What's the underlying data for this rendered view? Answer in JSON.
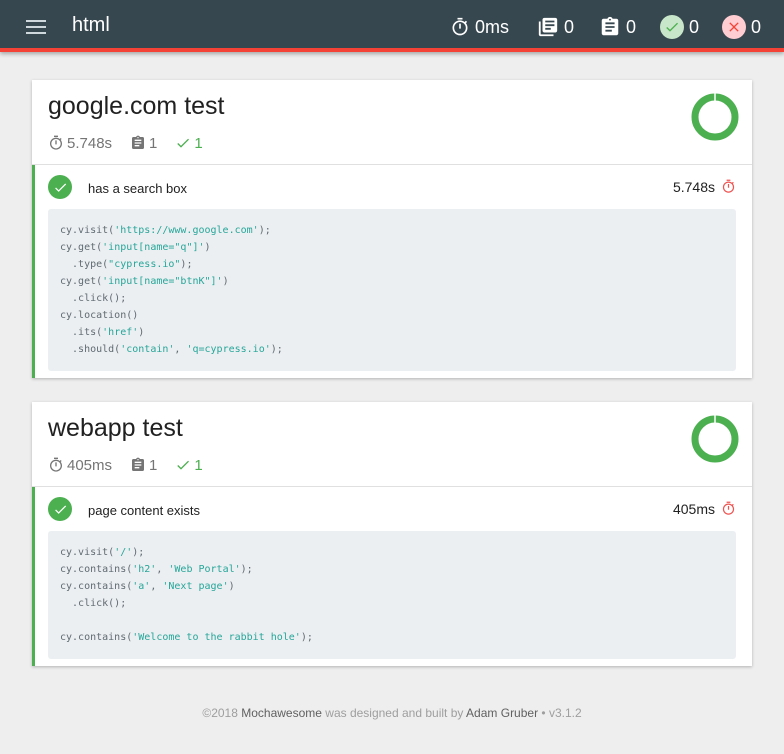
{
  "navbar": {
    "title": "html",
    "duration": "0ms",
    "suites": "0",
    "tests": "0",
    "passed": "0",
    "failed": "0"
  },
  "suites": [
    {
      "title": "google.com test",
      "duration": "5.748s",
      "tests": "1",
      "passes": "1",
      "pass_fraction": 1.0,
      "test": {
        "title": "has a search box",
        "duration": "5.748s",
        "code": [
          "cy.visit('https://www.google.com');",
          "cy.get('input[name=\"q\"]')",
          "  .type(\"cypress.io\");",
          "cy.get('input[name=\"btnK\"]')",
          "  .click();",
          "cy.location()",
          "  .its('href')",
          "  .should('contain', 'q=cypress.io');"
        ]
      }
    },
    {
      "title": "webapp test",
      "duration": "405ms",
      "tests": "1",
      "passes": "1",
      "pass_fraction": 1.0,
      "test": {
        "title": "page content exists",
        "duration": "405ms",
        "code": [
          "cy.visit('/');",
          "cy.contains('h2', 'Web Portal');",
          "cy.contains('a', 'Next page')",
          "  .click();",
          "",
          "cy.contains('Welcome to the rabbit hole');"
        ]
      }
    }
  ],
  "footer": {
    "copyright": "©2018 ",
    "brand": "Mochawesome",
    "middle": " was designed and built by ",
    "author": "Adam Gruber",
    "version": " • v3.1.2"
  },
  "colors": {
    "navbar": "#37474f",
    "accent_fail": "#f44336",
    "pass": "#4caf50",
    "code_bg": "#eceff1",
    "code_string": "#26a69a"
  },
  "icons": {
    "menu": "hamburger-menu-icon",
    "duration": "stopwatch-icon",
    "suites": "library-books-icon",
    "tests": "clipboard-icon",
    "passed": "check-icon",
    "failed": "close-icon"
  }
}
